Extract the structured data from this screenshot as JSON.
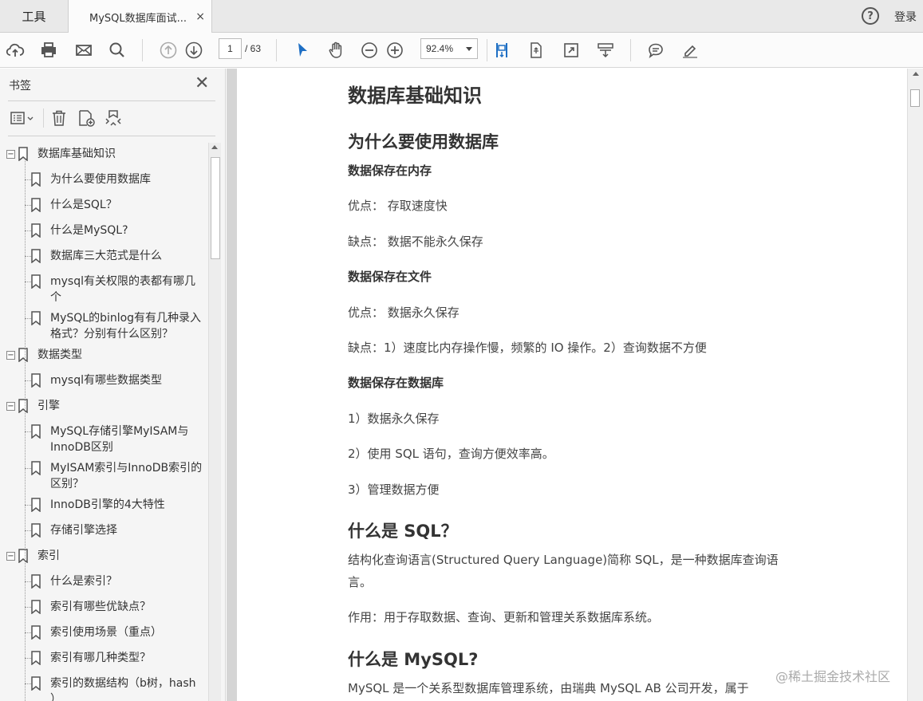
{
  "tabs": {
    "tools_label": "工具",
    "doc_label": "MySQL数据库面试...",
    "close_glyph": "×"
  },
  "topright": {
    "help_glyph": "?",
    "login_label": "登录"
  },
  "toolbar": {
    "page_current": "1",
    "page_total": "/ 63",
    "zoom": "92.4%"
  },
  "bookmarks_panel": {
    "title": "书签",
    "close_glyph": "✕",
    "items": [
      {
        "label": "数据库基础知识",
        "level": 0,
        "expand": "⊟"
      },
      {
        "label": "为什么要使用数据库",
        "level": 1
      },
      {
        "label": "什么是SQL？",
        "level": 1
      },
      {
        "label": "什么是MySQL?",
        "level": 1
      },
      {
        "label": "数据库三大范式是什么",
        "level": 1
      },
      {
        "label": "mysql有关权限的表都有哪几",
        "label2": "个",
        "level": 1
      },
      {
        "label": "MySQL的binlog有有几种录入",
        "label2": "格式？分别有什么区别？",
        "level": 1
      },
      {
        "label": "数据类型",
        "level": 0,
        "expand": "⊟"
      },
      {
        "label": "mysql有哪些数据类型",
        "level": 1
      },
      {
        "label": "引擎",
        "level": 0,
        "expand": "⊟"
      },
      {
        "label": "MySQL存储引擎MyISAM与",
        "label2": "InnoDB区别",
        "level": 1
      },
      {
        "label": "MyISAM索引与InnoDB索引的",
        "label2": "区别？",
        "level": 1
      },
      {
        "label": "InnoDB引擎的4大特性",
        "level": 1
      },
      {
        "label": "存储引擎选择",
        "level": 1
      },
      {
        "label": "索引",
        "level": 0,
        "expand": "⊟"
      },
      {
        "label": "什么是索引？",
        "level": 1
      },
      {
        "label": "索引有哪些优缺点？",
        "level": 1
      },
      {
        "label": "索引使用场景（重点）",
        "level": 1
      },
      {
        "label": "索引有哪几种类型？",
        "level": 1
      },
      {
        "label": "索引的数据结构（b树，hash",
        "label2": "）",
        "level": 1
      }
    ]
  },
  "document": {
    "h1": "数据库基础知识",
    "h2_why": "为什么要使用数据库",
    "h3_memory": "数据保存在内存",
    "p_mem_pro": "优点：  存取速度快",
    "p_mem_con": "缺点：  数据不能永久保存",
    "h3_file": "数据保存在文件",
    "p_file_pro": "优点：  数据永久保存",
    "p_file_con": "缺点：1）速度比内存操作慢，频繁的 IO 操作。2）查询数据不方便",
    "h3_db": "数据保存在数据库",
    "p_db_1": "1）数据永久保存",
    "p_db_2": "2）使用 SQL 语句，查询方便效率高。",
    "p_db_3": "3）管理数据方便",
    "h2_sql": "什么是 SQL？",
    "p_sql_1": "结构化查询语言(Structured Query Language)简称 SQL，是一种数据库查询语",
    "p_sql_1b": "言。",
    "p_sql_2": "作用：用于存取数据、查询、更新和管理关系数据库系统。",
    "h2_mysql": "什么是 MySQL?",
    "p_mysql_1": "MySQL 是一个关系型数据库管理系统，由瑞典 MySQL AB  公司开发，属于"
  },
  "watermark": "@稀土掘金技术社区"
}
